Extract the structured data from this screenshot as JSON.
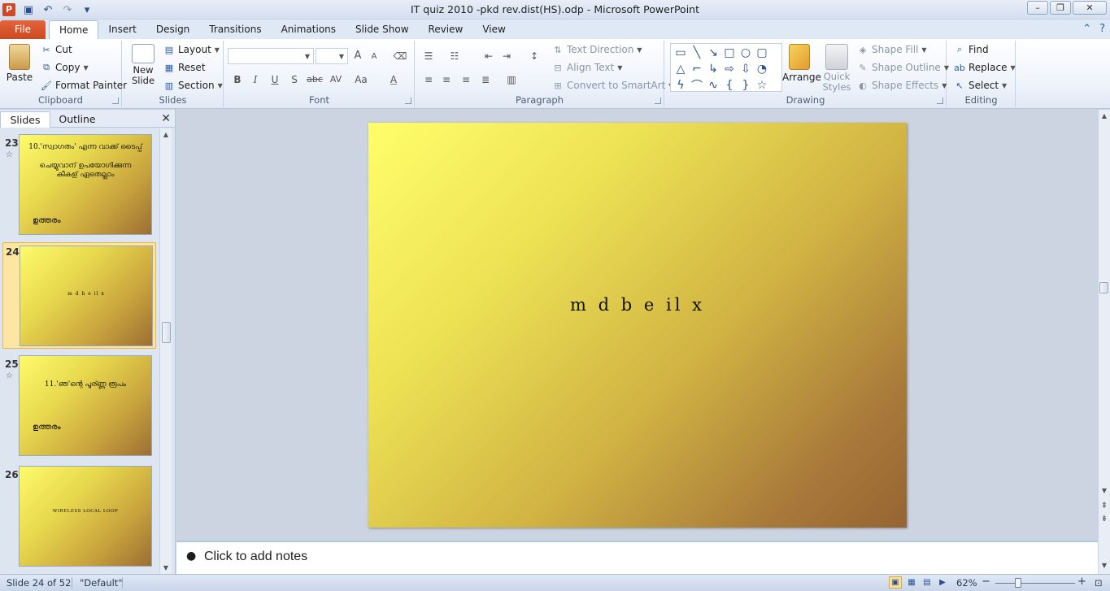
{
  "window": {
    "title": "IT quiz 2010 -pkd rev.dist(HS).odp  -  Microsoft PowerPoint",
    "app_icon_letter": "P",
    "minimize": "–",
    "maximize": "❐",
    "close": "✕"
  },
  "ribbon_tabs": {
    "file": "File",
    "items": [
      "Home",
      "Insert",
      "Design",
      "Transitions",
      "Animations",
      "Slide Show",
      "Review",
      "View"
    ],
    "active": "Home"
  },
  "clipboard": {
    "paste": "Paste",
    "cut": "Cut",
    "copy": "Copy",
    "format_painter": "Format Painter",
    "label": "Clipboard"
  },
  "slides_group": {
    "new_slide": "New Slide",
    "layout": "Layout",
    "reset": "Reset",
    "section": "Section",
    "label": "Slides"
  },
  "font_group": {
    "label": "Font",
    "bold": "B",
    "italic": "I",
    "underline": "U",
    "shadow": "S",
    "strike": "abc",
    "spacing": "AV",
    "case": "Aa",
    "color": "A",
    "grow": "A",
    "shrink": "A"
  },
  "paragraph_group": {
    "label": "Paragraph",
    "text_direction": "Text Direction",
    "align_text": "Align Text",
    "convert_smartart": "Convert to SmartArt"
  },
  "drawing_group": {
    "label": "Drawing",
    "arrange": "Arrange",
    "quick_styles": "Quick Styles",
    "shape_fill": "Shape Fill",
    "shape_outline": "Shape Outline",
    "shape_effects": "Shape Effects"
  },
  "editing_group": {
    "label": "Editing",
    "find": "Find",
    "replace": "Replace",
    "select": "Select"
  },
  "slide_pane": {
    "tab_slides": "Slides",
    "tab_outline": "Outline",
    "close": "✕",
    "thumbnails": [
      {
        "number": "23",
        "line1": "10.'സ്വാഗതം' എന്ന വാക്ക് ടൈപ്പ്",
        "line2": "ചെയ്യുവാന് ഉപയോഗിക്കുന്ന",
        "line3": "കീകള് ഏതെല്ലാം",
        "answer": "ഉത്തരം"
      },
      {
        "number": "24",
        "line1": "m d b e il x"
      },
      {
        "number": "25",
        "line1": "11.'ഞ'ന്റെ പൂര്ണ്ണ രൂപം",
        "answer": "ഉത്തരം"
      },
      {
        "number": "26",
        "line1": "WIRELESS LOCAL LOOP"
      }
    ]
  },
  "slide": {
    "text": "m d b e il x"
  },
  "notes": {
    "bullet": "●",
    "placeholder": "Click to add notes"
  },
  "status": {
    "slide_info": "Slide 24 of 52",
    "theme": "\"Default\"",
    "zoom": "62%",
    "zoom_out": "−",
    "zoom_in": "+"
  }
}
